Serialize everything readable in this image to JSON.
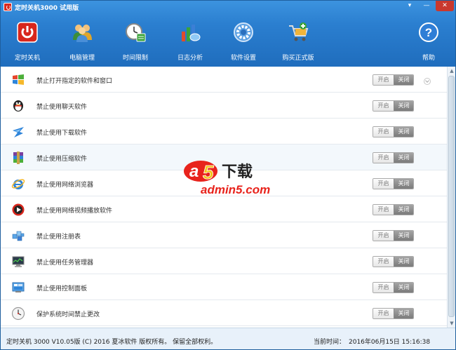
{
  "window": {
    "title": "定时关机3000 试用版"
  },
  "titlebar_buttons": [
    "▾",
    "—",
    "✕"
  ],
  "toolbar": {
    "items": [
      {
        "label": "定时关机",
        "icon": "power-icon"
      },
      {
        "label": "电脑管理",
        "icon": "users-icon"
      },
      {
        "label": "时间限制",
        "icon": "clock-icon"
      },
      {
        "label": "日志分析",
        "icon": "chart-icon"
      },
      {
        "label": "软件设置",
        "icon": "gear-icon"
      },
      {
        "label": "购买正式版",
        "icon": "cart-icon"
      }
    ],
    "help": {
      "label": "帮助",
      "icon": "help-icon"
    }
  },
  "rows": [
    {
      "label": "禁止打开指定的软件和窗口",
      "icon": "windows-icon",
      "on": "开启",
      "off": "关闭",
      "state": "off"
    },
    {
      "label": "禁止使用聊天软件",
      "icon": "qq-penguin-icon",
      "on": "开启",
      "off": "关闭",
      "state": "off"
    },
    {
      "label": "禁止使用下载软件",
      "icon": "thunder-download-icon",
      "on": "开启",
      "off": "关闭",
      "state": "off"
    },
    {
      "label": "禁止使用压缩软件",
      "icon": "winrar-icon",
      "on": "开启",
      "off": "关闭",
      "state": "off"
    },
    {
      "label": "禁止使用网络浏览器",
      "icon": "ie-browser-icon",
      "on": "开启",
      "off": "关闭",
      "state": "off"
    },
    {
      "label": "禁止使用网络视频播放软件",
      "icon": "video-player-icon",
      "on": "开启",
      "off": "关闭",
      "state": "off"
    },
    {
      "label": "禁止使用注册表",
      "icon": "registry-icon",
      "on": "开启",
      "off": "关闭",
      "state": "off"
    },
    {
      "label": "禁止使用任务管理器",
      "icon": "task-manager-icon",
      "on": "开启",
      "off": "关闭",
      "state": "off"
    },
    {
      "label": "禁止使用控制面板",
      "icon": "control-panel-icon",
      "on": "开启",
      "off": "关闭",
      "state": "off"
    },
    {
      "label": "保护系统时间禁止更改",
      "icon": "system-clock-icon",
      "on": "开启",
      "off": "关闭",
      "state": "off"
    }
  ],
  "watermark": {
    "brand": "a5下载",
    "site": "admin5.com"
  },
  "status": {
    "copyright": "定时关机 3000 V10.05版 (C) 2016  夏冰软件 版权所有。 保留全部权利。",
    "time_label": "当前时间：",
    "time_value": "2016年06月15日  15:16:38"
  },
  "colors": {
    "header": "#2b7fd0",
    "close": "#c9382e",
    "toggle_off": "#8e8e8e"
  }
}
